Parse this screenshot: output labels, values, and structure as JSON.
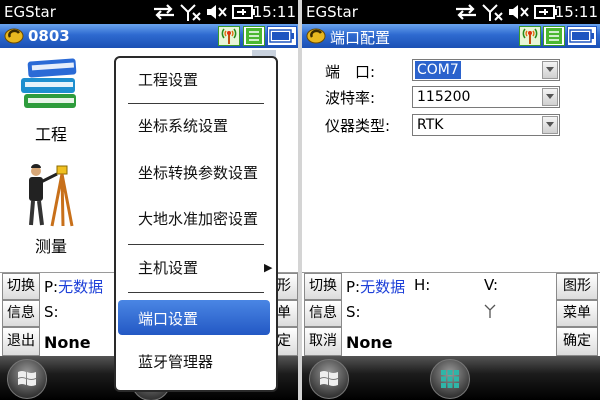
{
  "colors": {
    "status_bg": "#000000",
    "titlebar_top": "#6aa4ee",
    "titlebar_bottom": "#1b50b4",
    "selection": "#2b62cc",
    "info_blue": "#1c3fd8"
  },
  "left": {
    "status": {
      "app": "EGStar",
      "time": "15:11"
    },
    "title": "0803",
    "title_icon": "egstar-logo-icon",
    "home_items": [
      {
        "label": "工程",
        "icon": "books-icon"
      },
      {
        "label": "测量",
        "icon": "surveyor-tripod-icon"
      }
    ],
    "menu": {
      "items": [
        {
          "label": "工程设置"
        },
        {
          "label": "坐标系统设置"
        },
        {
          "label": "坐标转换参数设置"
        },
        {
          "label": "大地水准加密设置"
        },
        {
          "label": "主机设置",
          "has_submenu": true
        },
        {
          "label": "端口设置",
          "selected": true
        },
        {
          "label": "蓝牙管理器"
        }
      ]
    },
    "panel": {
      "buttons_left": [
        "切换",
        "信息",
        "退出"
      ],
      "buttons_right": [
        "图形",
        "菜单",
        "确定"
      ],
      "p_label": "P:",
      "p_value": "无数据",
      "s_label": "S:",
      "solution": "None"
    }
  },
  "right": {
    "status": {
      "app": "EGStar",
      "time": "15:11"
    },
    "title": "端口配置",
    "title_icon": "egstar-logo-icon",
    "form": {
      "fields": [
        {
          "label": "端　口:",
          "value": "COM7",
          "focused": true
        },
        {
          "label": "波特率:",
          "value": "115200"
        },
        {
          "label": "仪器类型:",
          "value": "RTK"
        }
      ]
    },
    "panel": {
      "buttons_left": [
        "切换",
        "信息",
        "取消"
      ],
      "buttons_right": [
        "图形",
        "菜单",
        "确定"
      ],
      "p_label": "P:",
      "p_value": "无数据",
      "h_label": "H:",
      "v_label": "V:",
      "s_label": "S:",
      "solution": "None"
    }
  }
}
